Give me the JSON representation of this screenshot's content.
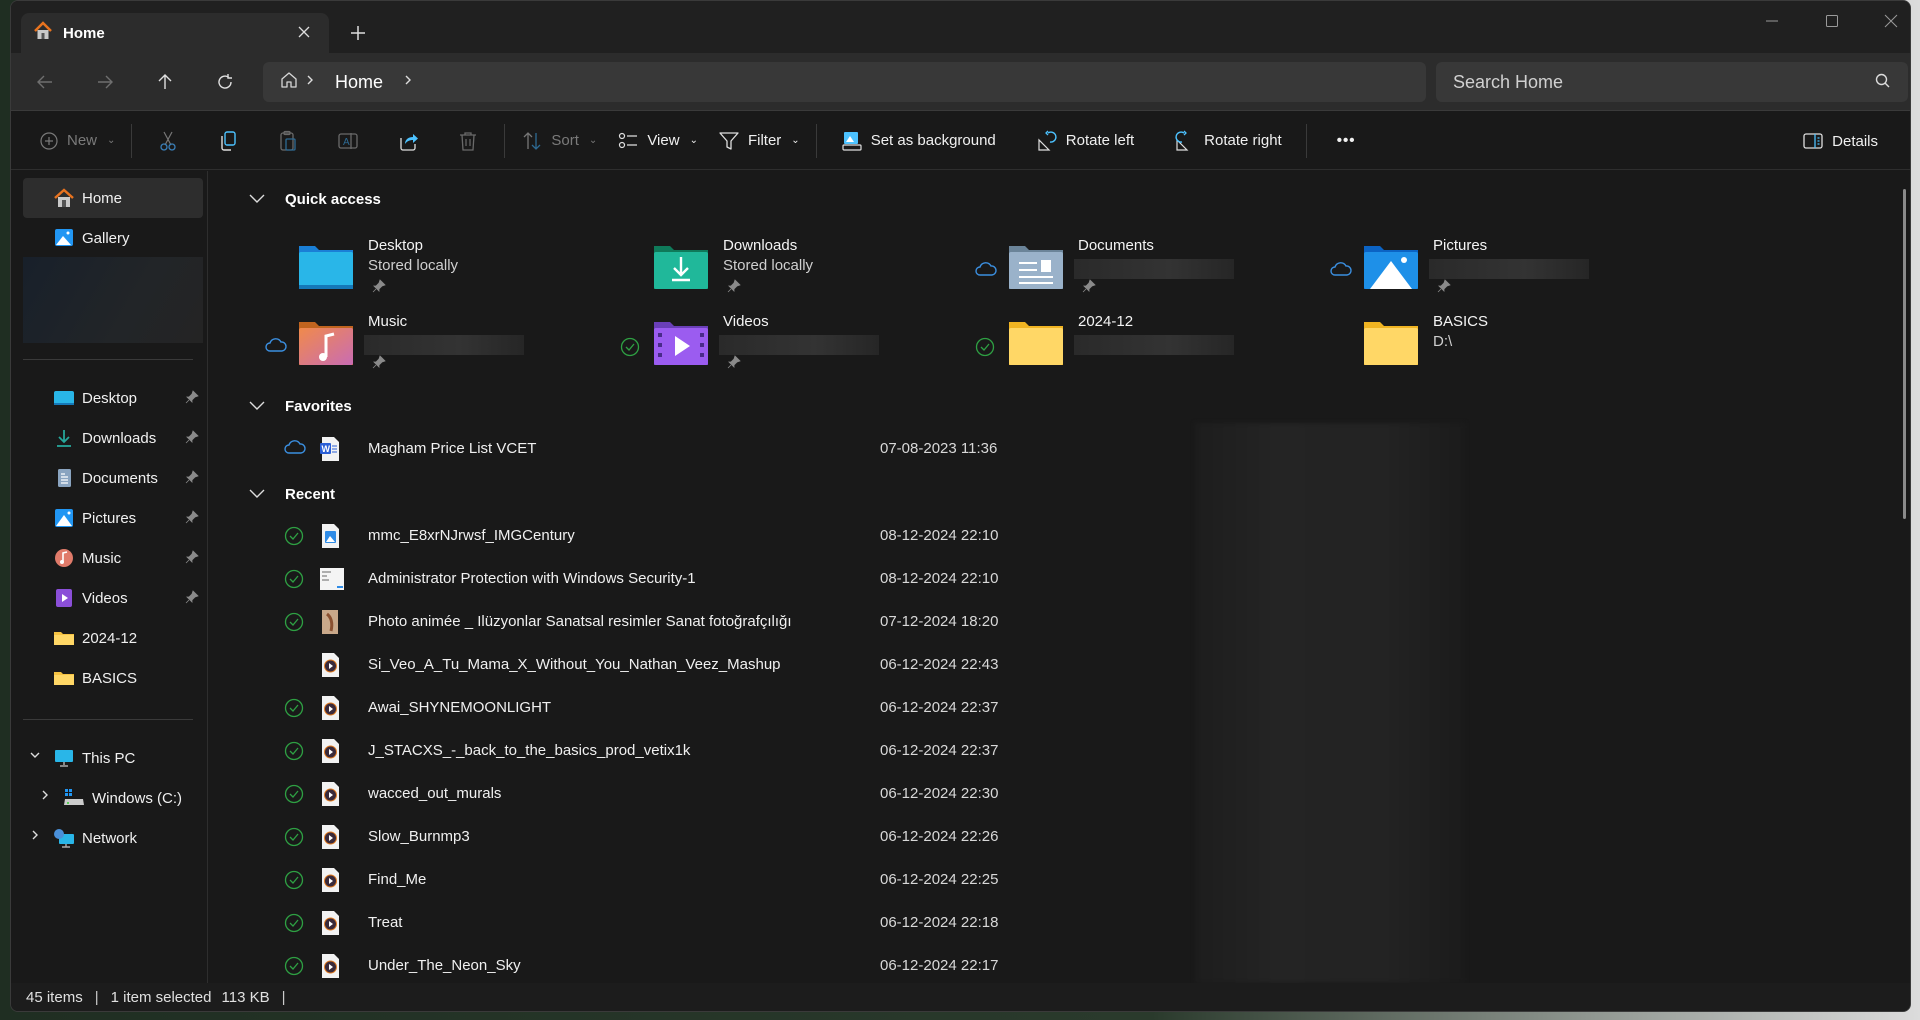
{
  "window": {
    "tab_title": "Home",
    "tab_icon": "home-icon",
    "new_tab_label": "+",
    "controls": [
      "minimize",
      "maximize",
      "close"
    ]
  },
  "nav": {
    "back": "back-arrow-icon",
    "forward": "forward-arrow-icon",
    "up": "up-arrow-icon",
    "refresh": "refresh-icon",
    "breadcrumb": [
      "Home"
    ],
    "search_placeholder": "Search Home"
  },
  "toolbar": {
    "new_label": "New",
    "sort_label": "Sort",
    "view_label": "View",
    "filter_label": "Filter",
    "set_background_label": "Set as background",
    "rotate_left_label": "Rotate left",
    "rotate_right_label": "Rotate right",
    "more_label": "•••",
    "details_label": "Details",
    "icons": [
      "cut-icon",
      "copy-icon",
      "paste-icon",
      "rename-icon",
      "share-icon",
      "delete-icon"
    ]
  },
  "sidebar": {
    "top": [
      {
        "label": "Home",
        "icon": "home-icon",
        "selected": true
      },
      {
        "label": "Gallery",
        "icon": "gallery-icon"
      }
    ],
    "pinned": [
      {
        "label": "Desktop",
        "icon": "desktop-folder-icon",
        "pinned": true
      },
      {
        "label": "Downloads",
        "icon": "downloads-icon",
        "pinned": true
      },
      {
        "label": "Documents",
        "icon": "documents-icon",
        "pinned": true
      },
      {
        "label": "Pictures",
        "icon": "pictures-icon",
        "pinned": true
      },
      {
        "label": "Music",
        "icon": "music-icon",
        "pinned": true
      },
      {
        "label": "Videos",
        "icon": "videos-icon",
        "pinned": true
      },
      {
        "label": "2024-12",
        "icon": "folder-icon"
      },
      {
        "label": "BASICS",
        "icon": "folder-icon"
      }
    ],
    "tree": [
      {
        "label": "This PC",
        "icon": "computer-icon",
        "expanded": true
      },
      {
        "label": "Windows (C:)",
        "icon": "drive-icon",
        "expanded": false
      },
      {
        "label": "Network",
        "icon": "network-icon",
        "expanded": false
      }
    ]
  },
  "quick_access": {
    "title": "Quick access",
    "tiles": [
      {
        "name": "Desktop",
        "sub": "Stored locally",
        "status": "",
        "pinned": true
      },
      {
        "name": "Downloads",
        "sub": "Stored locally",
        "status": "",
        "pinned": true
      },
      {
        "name": "Documents",
        "sub": "",
        "status": "cloud",
        "pinned": true
      },
      {
        "name": "Pictures",
        "sub": "",
        "status": "cloud",
        "pinned": true
      },
      {
        "name": "Music",
        "sub": "",
        "status": "cloud",
        "pinned": true
      },
      {
        "name": "Videos",
        "sub": "",
        "status": "synced",
        "pinned": true
      },
      {
        "name": "2024-12",
        "sub": "",
        "status": "synced",
        "pinned": false
      },
      {
        "name": "BASICS",
        "sub": "D:\\",
        "status": "",
        "pinned": false
      }
    ]
  },
  "favorites": {
    "title": "Favorites",
    "items": [
      {
        "name": "Magham Price List VCET",
        "date": "07-08-2023 11:36",
        "status": "cloud",
        "type": "word"
      }
    ]
  },
  "recent": {
    "title": "Recent",
    "items": [
      {
        "name": "mmc_E8xrNJrwsf_IMGCentury",
        "date": "08-12-2024 22:10",
        "status": "synced",
        "type": "image"
      },
      {
        "name": "Administrator Protection with Windows Security-1",
        "date": "08-12-2024 22:10",
        "status": "synced",
        "type": "screenshot"
      },
      {
        "name": "Photo animée _ Ilüzyonlar Sanatsal resimler Sanat fotoğrafçılığı",
        "date": "07-12-2024 18:20",
        "status": "synced",
        "type": "photo"
      },
      {
        "name": "Si_Veo_A_Tu_Mama_X_Without_You_Nathan_Veez_Mashup",
        "date": "06-12-2024 22:43",
        "status": "",
        "type": "media"
      },
      {
        "name": "Awai_SHYNEMOONLIGHT",
        "date": "06-12-2024 22:37",
        "status": "synced",
        "type": "media"
      },
      {
        "name": "J_STACXS_-_back_to_the_basics_prod_vetix1k",
        "date": "06-12-2024 22:37",
        "status": "synced",
        "type": "media"
      },
      {
        "name": "wacced_out_murals",
        "date": "06-12-2024 22:30",
        "status": "synced",
        "type": "media"
      },
      {
        "name": "Slow_Burnmp3",
        "date": "06-12-2024 22:26",
        "status": "synced",
        "type": "media"
      },
      {
        "name": "Find_Me",
        "date": "06-12-2024 22:25",
        "status": "synced",
        "type": "media"
      },
      {
        "name": "Treat",
        "date": "06-12-2024 22:18",
        "status": "synced",
        "type": "media"
      },
      {
        "name": "Under_The_Neon_Sky",
        "date": "06-12-2024 22:17",
        "status": "synced",
        "type": "media"
      }
    ]
  },
  "status": {
    "items_count": "45 items",
    "selection": "1 item selected",
    "size": "113 KB"
  },
  "colors": {
    "cloud": "#3b8fe0",
    "synced": "#2ea043",
    "accent": "#4cc2ff"
  }
}
